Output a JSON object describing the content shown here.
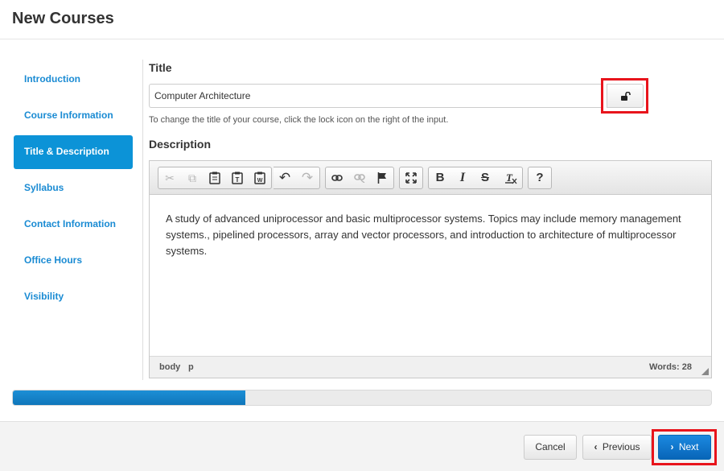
{
  "modal": {
    "title": "New Courses"
  },
  "sidebar": {
    "items": [
      {
        "label": "Introduction",
        "active": false
      },
      {
        "label": "Course Information",
        "active": false
      },
      {
        "label": "Title & Description",
        "active": true
      },
      {
        "label": "Syllabus",
        "active": false
      },
      {
        "label": "Contact Information",
        "active": false
      },
      {
        "label": "Office Hours",
        "active": false
      },
      {
        "label": "Visibility",
        "active": false
      }
    ]
  },
  "title_section": {
    "label": "Title",
    "value": "Computer Architecture",
    "lock_icon": "unlocked-padlock-icon",
    "help_text": "To change the title of your course, click the lock icon on the right of the input."
  },
  "description_section": {
    "label": "Description",
    "toolbar": {
      "bold": "B",
      "italic": "I",
      "strike": "S",
      "help": "?"
    },
    "body_text": "A study of advanced uniprocessor and basic multiprocessor systems. Topics may include memory management systems., pipelined processors, array and vector processors, and introduction to architecture of multiprocessor systems.",
    "status": {
      "path_body": "body",
      "path_p": "p",
      "word_count": "Words: 28"
    }
  },
  "progress": {
    "fraction": 0.333
  },
  "footer": {
    "cancel_label": "Cancel",
    "previous_label": "Previous",
    "next_label": "Next",
    "prev_icon": "‹",
    "next_icon": "›"
  },
  "colors": {
    "accent": "#0c93d7",
    "link": "#1a8bd3",
    "highlight": "#e8141c",
    "next_button": "#0865b8"
  }
}
